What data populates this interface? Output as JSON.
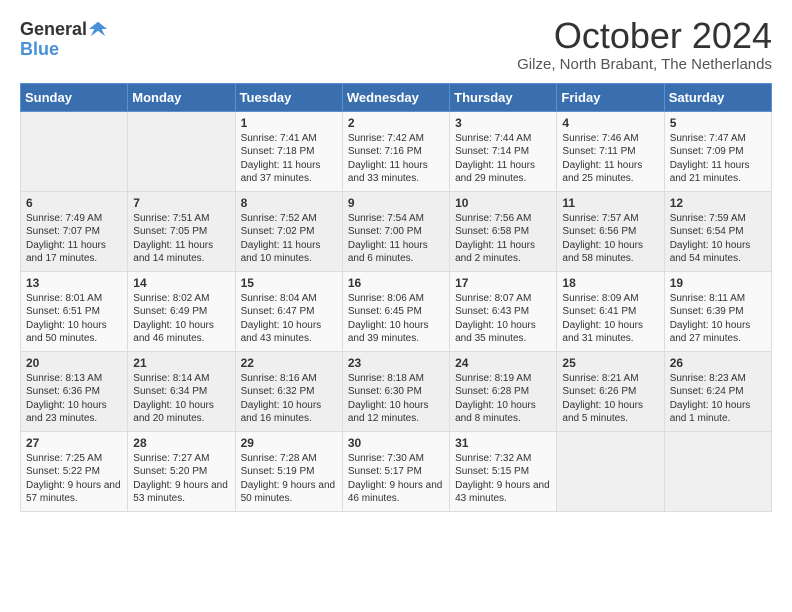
{
  "logo": {
    "general": "General",
    "blue": "Blue"
  },
  "title": "October 2024",
  "location": "Gilze, North Brabant, The Netherlands",
  "days_header": [
    "Sunday",
    "Monday",
    "Tuesday",
    "Wednesday",
    "Thursday",
    "Friday",
    "Saturday"
  ],
  "weeks": [
    [
      {
        "day": "",
        "info": ""
      },
      {
        "day": "",
        "info": ""
      },
      {
        "day": "1",
        "info": "Sunrise: 7:41 AM\nSunset: 7:18 PM\nDaylight: 11 hours and 37 minutes."
      },
      {
        "day": "2",
        "info": "Sunrise: 7:42 AM\nSunset: 7:16 PM\nDaylight: 11 hours and 33 minutes."
      },
      {
        "day": "3",
        "info": "Sunrise: 7:44 AM\nSunset: 7:14 PM\nDaylight: 11 hours and 29 minutes."
      },
      {
        "day": "4",
        "info": "Sunrise: 7:46 AM\nSunset: 7:11 PM\nDaylight: 11 hours and 25 minutes."
      },
      {
        "day": "5",
        "info": "Sunrise: 7:47 AM\nSunset: 7:09 PM\nDaylight: 11 hours and 21 minutes."
      }
    ],
    [
      {
        "day": "6",
        "info": "Sunrise: 7:49 AM\nSunset: 7:07 PM\nDaylight: 11 hours and 17 minutes."
      },
      {
        "day": "7",
        "info": "Sunrise: 7:51 AM\nSunset: 7:05 PM\nDaylight: 11 hours and 14 minutes."
      },
      {
        "day": "8",
        "info": "Sunrise: 7:52 AM\nSunset: 7:02 PM\nDaylight: 11 hours and 10 minutes."
      },
      {
        "day": "9",
        "info": "Sunrise: 7:54 AM\nSunset: 7:00 PM\nDaylight: 11 hours and 6 minutes."
      },
      {
        "day": "10",
        "info": "Sunrise: 7:56 AM\nSunset: 6:58 PM\nDaylight: 11 hours and 2 minutes."
      },
      {
        "day": "11",
        "info": "Sunrise: 7:57 AM\nSunset: 6:56 PM\nDaylight: 10 hours and 58 minutes."
      },
      {
        "day": "12",
        "info": "Sunrise: 7:59 AM\nSunset: 6:54 PM\nDaylight: 10 hours and 54 minutes."
      }
    ],
    [
      {
        "day": "13",
        "info": "Sunrise: 8:01 AM\nSunset: 6:51 PM\nDaylight: 10 hours and 50 minutes."
      },
      {
        "day": "14",
        "info": "Sunrise: 8:02 AM\nSunset: 6:49 PM\nDaylight: 10 hours and 46 minutes."
      },
      {
        "day": "15",
        "info": "Sunrise: 8:04 AM\nSunset: 6:47 PM\nDaylight: 10 hours and 43 minutes."
      },
      {
        "day": "16",
        "info": "Sunrise: 8:06 AM\nSunset: 6:45 PM\nDaylight: 10 hours and 39 minutes."
      },
      {
        "day": "17",
        "info": "Sunrise: 8:07 AM\nSunset: 6:43 PM\nDaylight: 10 hours and 35 minutes."
      },
      {
        "day": "18",
        "info": "Sunrise: 8:09 AM\nSunset: 6:41 PM\nDaylight: 10 hours and 31 minutes."
      },
      {
        "day": "19",
        "info": "Sunrise: 8:11 AM\nSunset: 6:39 PM\nDaylight: 10 hours and 27 minutes."
      }
    ],
    [
      {
        "day": "20",
        "info": "Sunrise: 8:13 AM\nSunset: 6:36 PM\nDaylight: 10 hours and 23 minutes."
      },
      {
        "day": "21",
        "info": "Sunrise: 8:14 AM\nSunset: 6:34 PM\nDaylight: 10 hours and 20 minutes."
      },
      {
        "day": "22",
        "info": "Sunrise: 8:16 AM\nSunset: 6:32 PM\nDaylight: 10 hours and 16 minutes."
      },
      {
        "day": "23",
        "info": "Sunrise: 8:18 AM\nSunset: 6:30 PM\nDaylight: 10 hours and 12 minutes."
      },
      {
        "day": "24",
        "info": "Sunrise: 8:19 AM\nSunset: 6:28 PM\nDaylight: 10 hours and 8 minutes."
      },
      {
        "day": "25",
        "info": "Sunrise: 8:21 AM\nSunset: 6:26 PM\nDaylight: 10 hours and 5 minutes."
      },
      {
        "day": "26",
        "info": "Sunrise: 8:23 AM\nSunset: 6:24 PM\nDaylight: 10 hours and 1 minute."
      }
    ],
    [
      {
        "day": "27",
        "info": "Sunrise: 7:25 AM\nSunset: 5:22 PM\nDaylight: 9 hours and 57 minutes."
      },
      {
        "day": "28",
        "info": "Sunrise: 7:27 AM\nSunset: 5:20 PM\nDaylight: 9 hours and 53 minutes."
      },
      {
        "day": "29",
        "info": "Sunrise: 7:28 AM\nSunset: 5:19 PM\nDaylight: 9 hours and 50 minutes."
      },
      {
        "day": "30",
        "info": "Sunrise: 7:30 AM\nSunset: 5:17 PM\nDaylight: 9 hours and 46 minutes."
      },
      {
        "day": "31",
        "info": "Sunrise: 7:32 AM\nSunset: 5:15 PM\nDaylight: 9 hours and 43 minutes."
      },
      {
        "day": "",
        "info": ""
      },
      {
        "day": "",
        "info": ""
      }
    ]
  ]
}
